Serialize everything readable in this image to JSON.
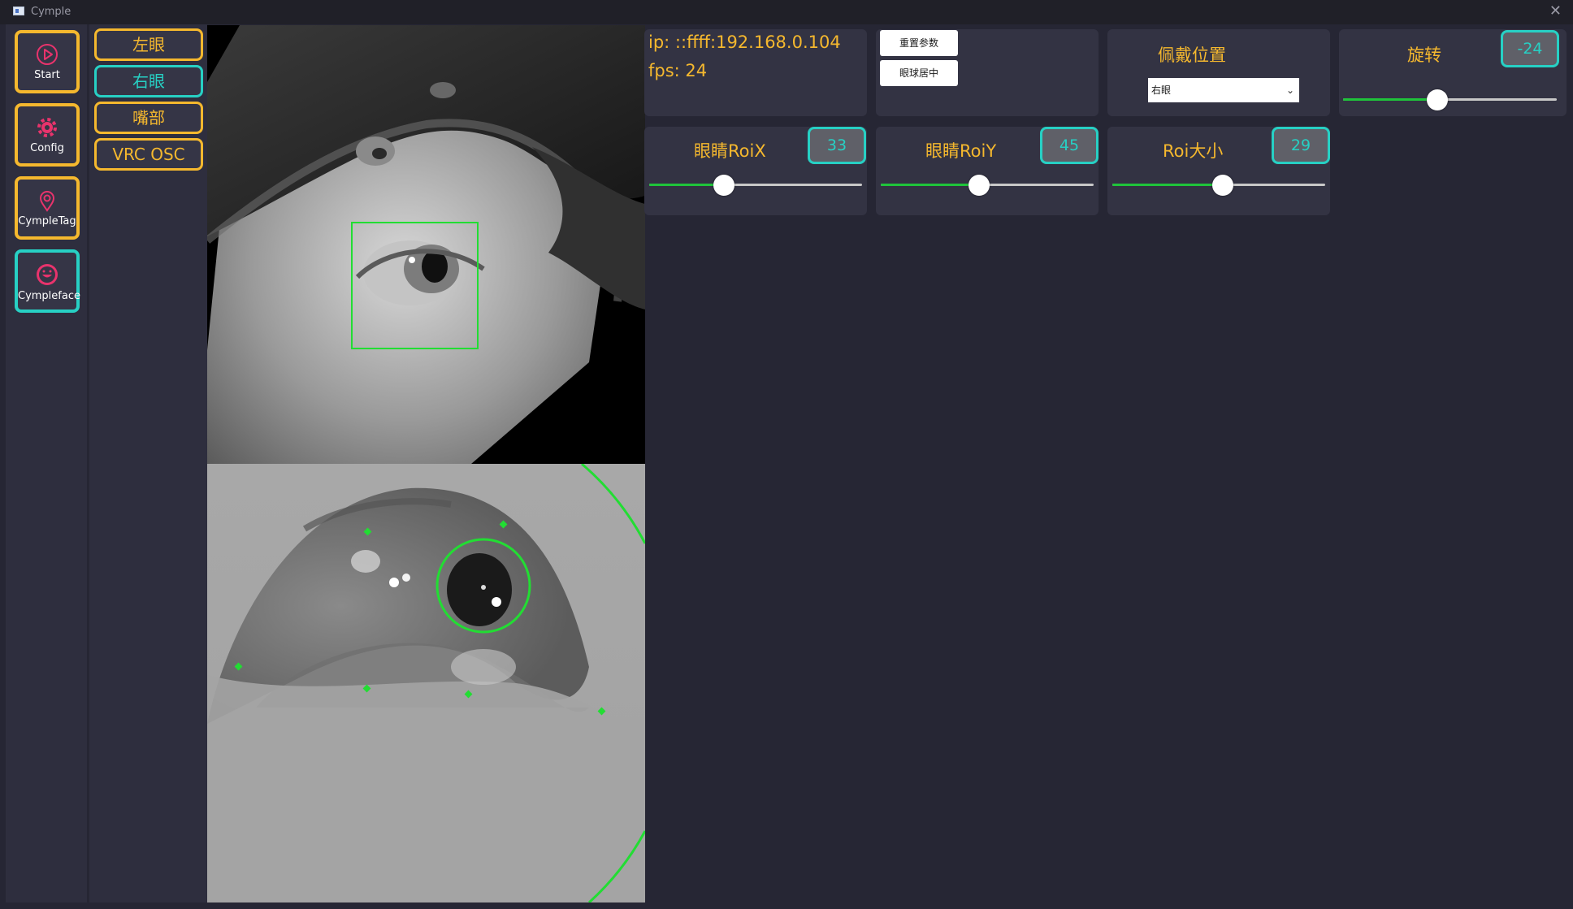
{
  "window": {
    "title": "Cymple",
    "close_glyph": "✕"
  },
  "nav": [
    {
      "label": "Start",
      "icon": "play-circle-icon"
    },
    {
      "label": "Config",
      "icon": "gear-icon"
    },
    {
      "label": "CympleTag",
      "icon": "location-pin-icon"
    },
    {
      "label": "Cympleface",
      "icon": "smiley-face-icon",
      "active": true
    }
  ],
  "subnav": [
    {
      "label": "左眼"
    },
    {
      "label": "右眼",
      "active": true
    },
    {
      "label": "嘴部"
    },
    {
      "label": "VRC OSC"
    }
  ],
  "status": {
    "ip": "ip: ::ffff:192.168.0.104",
    "fps": "fps: 24"
  },
  "actions": {
    "reset": "重置参数",
    "center": "眼球居中"
  },
  "wear": {
    "title": "佩戴位置",
    "selected": "右眼"
  },
  "rotate": {
    "title": "旋转",
    "value": "-24",
    "level": 0.44
  },
  "roi_x": {
    "title": "眼睛RoiX",
    "value": "33",
    "level": 0.35
  },
  "roi_y": {
    "title": "眼睛RoiY",
    "value": "45",
    "level": 0.46
  },
  "roi_size": {
    "title": "Roi大小",
    "value": "29",
    "level": 0.52
  },
  "colors": {
    "accent": "#f5b82e",
    "active": "#27d0c4",
    "slider_fill": "#1fc43a",
    "overlay": "#22dd33"
  }
}
